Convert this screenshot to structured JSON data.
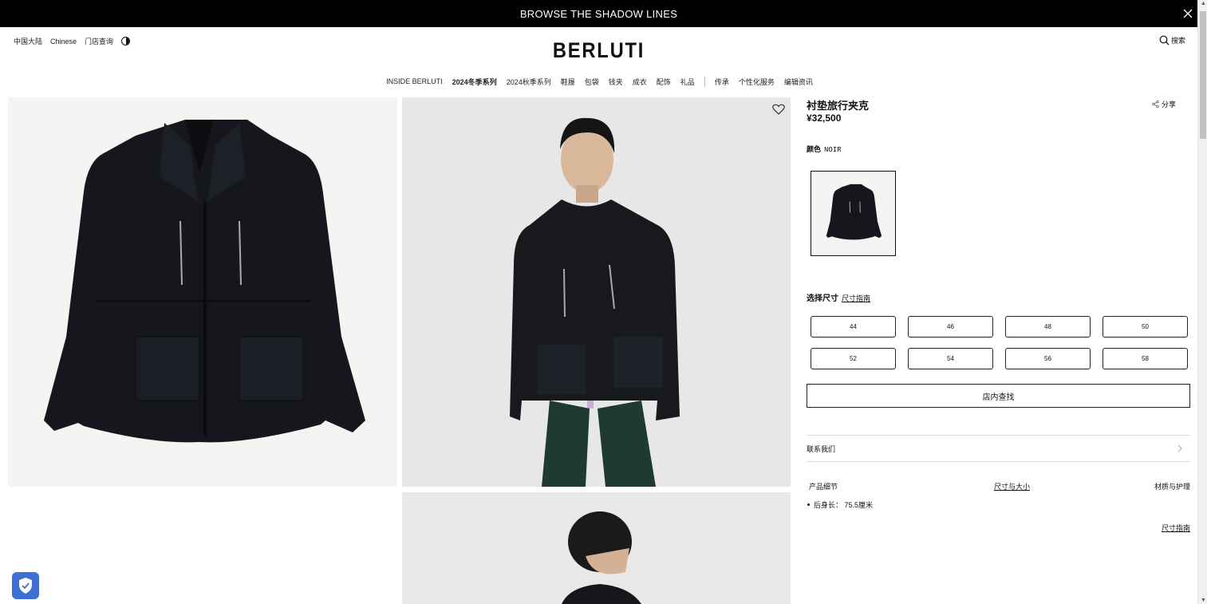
{
  "banner": {
    "text": "BROWSE THE SHADOW LINES",
    "close_icon": "close-icon"
  },
  "header": {
    "region": "中国大陆",
    "language": "Chinese",
    "store_locator": "门店查询",
    "contrast_icon": "contrast-icon",
    "logo": "BERLUTI",
    "search_label": "搜索",
    "search_icon": "search-icon"
  },
  "nav": {
    "items": [
      "INSIDE BERLUTI",
      "2024冬季系列",
      "2024秋季系列",
      "鞋履",
      "包袋",
      "钱夹",
      "成衣",
      "配饰",
      "礼品",
      "传承",
      "个性化服务",
      "编辑资讯"
    ]
  },
  "product": {
    "name": "衬垫旅行夹克",
    "price": "¥32,500",
    "share_label": "分享",
    "color_label": "颜色",
    "color_value": "NOIR",
    "size_label": "选择尺寸",
    "size_guide_link": "尺寸指南",
    "sizes": [
      "44",
      "46",
      "48",
      "50",
      "52",
      "54",
      "56",
      "58"
    ],
    "find_in_store": "店内查找",
    "contact_us": "联系我们",
    "tabs": [
      "产品细节",
      "尺寸与大小",
      "材质与护理"
    ],
    "details": [
      "后身长： 75.5厘米"
    ],
    "size_guide_bottom": "尺寸指南"
  },
  "colors": {
    "banner_bg": "#000000",
    "accent": "#111111",
    "privacy_badge": "#3d6fd6"
  }
}
